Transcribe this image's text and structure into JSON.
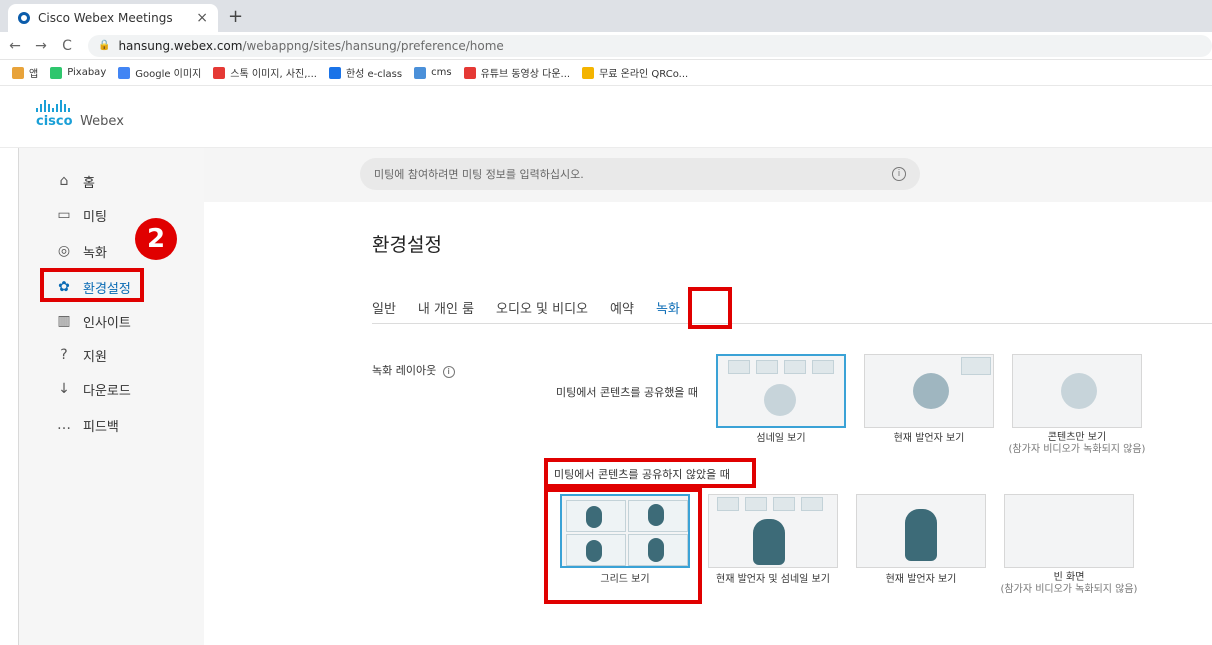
{
  "browser": {
    "tab_title": "Cisco Webex Meetings",
    "tab_close": "×",
    "new_tab": "+",
    "url_host": "hansung.webex.com",
    "url_path": "/webappng/sites/hansung/preference/home",
    "back": "←",
    "forward": "→",
    "reload": "C",
    "bookmarks": [
      {
        "label": "앱",
        "color": "#e8a33a"
      },
      {
        "label": "Pixabay",
        "color": "#2ec66d"
      },
      {
        "label": "Google 이미지",
        "color": "#4285f4"
      },
      {
        "label": "스톡 이미지, 사진,...",
        "color": "#e53935"
      },
      {
        "label": "한성 e-class",
        "color": "#1a73e8"
      },
      {
        "label": "cms",
        "color": "#4a90d9"
      },
      {
        "label": "유튜브 동영상 다운...",
        "color": "#e53935"
      },
      {
        "label": "무료 온라인 QRCo...",
        "color": "#f4b400"
      }
    ]
  },
  "header": {
    "brand": "cisco",
    "product": "Webex"
  },
  "sidebar": {
    "items": [
      {
        "icon": "home-icon",
        "glyph": "⌂",
        "label": "홈"
      },
      {
        "icon": "meeting-icon",
        "glyph": "▭",
        "label": "미팅"
      },
      {
        "icon": "record-icon",
        "glyph": "◎",
        "label": "녹화"
      },
      {
        "icon": "gear-icon",
        "glyph": "✿",
        "label": "환경설정"
      },
      {
        "icon": "insight-icon",
        "glyph": "▥",
        "label": "인사이트"
      },
      {
        "icon": "help-icon",
        "glyph": "?",
        "label": "지원"
      },
      {
        "icon": "download-icon",
        "glyph": "↓",
        "label": "다운로드"
      },
      {
        "icon": "feedback-icon",
        "glyph": "…",
        "label": "피드백"
      }
    ],
    "step_badge": "2"
  },
  "search": {
    "placeholder": "미팅에 참여하려면 미팅 정보를 입력하십시오.",
    "info": "i"
  },
  "page": {
    "title": "환경설정",
    "tabs": [
      "일반",
      "내 개인 룸",
      "오디오 및 비디오",
      "예약",
      "녹화"
    ],
    "active_tab": "녹화",
    "layout_label": "녹화 레이아웃",
    "sharing_label": "미팅에서 콘텐츠를 공유했을 때",
    "not_sharing_label": "미팅에서 콘텐츠를 공유하지 않았을 때",
    "sharing_options": [
      {
        "label": "섬네일 보기",
        "note": ""
      },
      {
        "label": "현재 발언자 보기",
        "note": ""
      },
      {
        "label": "콘텐츠만 보기",
        "note": "(참가자 비디오가 녹화되지 않음)"
      }
    ],
    "not_sharing_options": [
      {
        "label": "그리드 보기",
        "note": ""
      },
      {
        "label": "현재 발언자 및 섬네일 보기",
        "note": ""
      },
      {
        "label": "현재 발언자 보기",
        "note": ""
      },
      {
        "label": "빈 화면",
        "note": "(참가자 비디오가 녹화되지 않음)"
      }
    ]
  },
  "colors": {
    "accent": "#0a6bb5",
    "highlight": "#e00000",
    "selected_border": "#3aa2d6"
  }
}
